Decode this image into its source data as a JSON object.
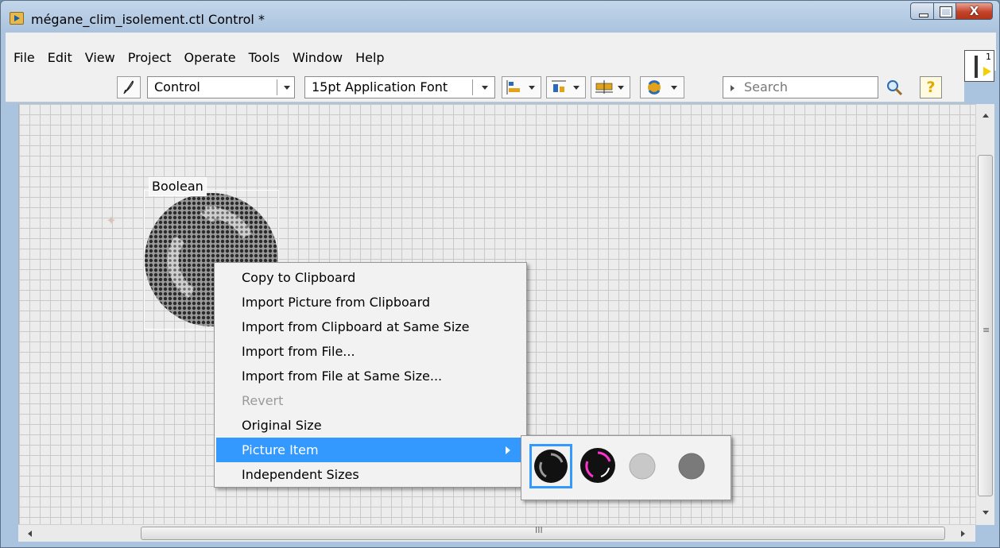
{
  "window": {
    "title": "mégane_clim_isolement.ctl Control *",
    "close_glyph": "X"
  },
  "menu": {
    "items": [
      "File",
      "Edit",
      "View",
      "Project",
      "Operate",
      "Tools",
      "Window",
      "Help"
    ]
  },
  "vi_icon": {
    "number": "1"
  },
  "toolbar": {
    "control_type": "Control",
    "font": "15pt Application Font",
    "search_placeholder": "Search",
    "help_glyph": "?"
  },
  "canvas": {
    "boolean_label": "Boolean"
  },
  "context_menu": {
    "items": [
      {
        "label": "Copy to Clipboard",
        "disabled": false
      },
      {
        "label": "Import Picture from Clipboard",
        "disabled": false
      },
      {
        "label": "Import from Clipboard at Same Size",
        "disabled": false
      },
      {
        "label": "Import from File...",
        "disabled": false
      },
      {
        "label": "Import from File at Same Size...",
        "disabled": false
      },
      {
        "label": "Revert",
        "disabled": true
      },
      {
        "label": "Original Size",
        "disabled": false
      },
      {
        "label": "Picture Item",
        "disabled": false,
        "active": true,
        "has_submenu": true
      },
      {
        "label": "Independent Sizes",
        "disabled": false
      }
    ]
  },
  "colors": {
    "highlight": "#3399ff",
    "disabled_text": "#9a9a9a"
  },
  "scrollbar": {
    "grip_v": "≡",
    "grip_h": "III"
  }
}
